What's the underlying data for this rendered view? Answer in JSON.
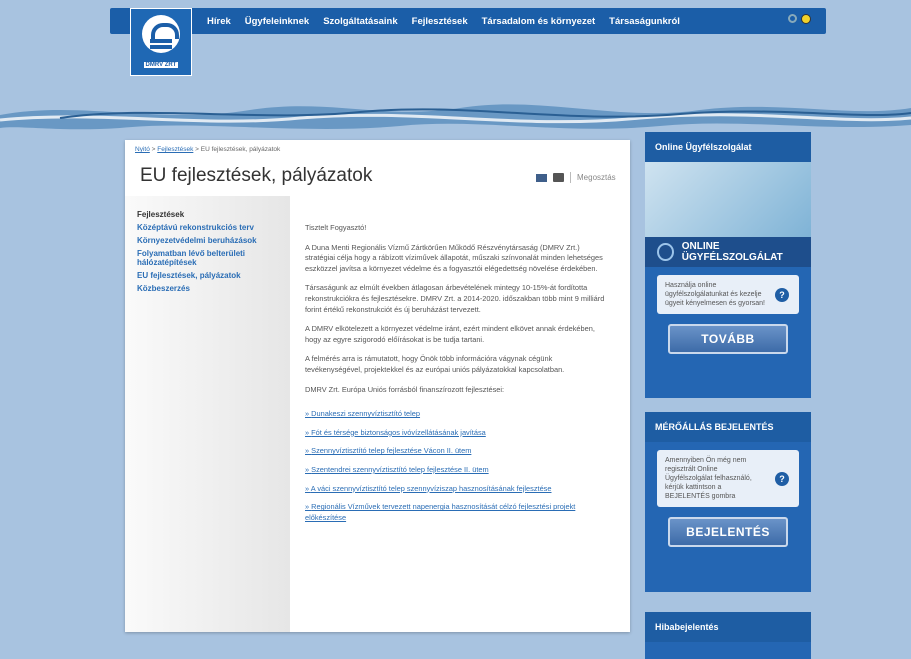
{
  "logo": {
    "text": "DMRV ZRT"
  },
  "nav": [
    "Hírek",
    "Ügyfeleinknek",
    "Szolgáltatásaink",
    "Fejlesztések",
    "Társadalom és környezet",
    "Társaságunkról"
  ],
  "breadcrumb": {
    "home": "Nyitó",
    "sep1": " > ",
    "parent": "Fejlesztések",
    "sep2": " > ",
    "current": "EU fejlesztések, pályázatok"
  },
  "page": {
    "title": "EU fejlesztések, pályázatok",
    "share": "Megosztás"
  },
  "leftnav": {
    "header": "Fejlesztések",
    "items": [
      "Középtávú rekonstrukciós terv",
      "Környezetvédelmi beruházások",
      "Folyamatban lévő belterületi hálózatépítések",
      "EU fejlesztések, pályázatok",
      "Közbeszerzés"
    ]
  },
  "main": {
    "greeting": "Tisztelt Fogyasztó!",
    "p1": "A Duna Menti Regionális Vízmű Zártkörűen Működő Részvénytársaság (DMRV Zrt.) stratégiai célja hogy a rábízott víziművek állapotát, műszaki színvonalát minden lehetséges eszközzel javítsa a környezet védelme és a fogyasztói elégedettség növelése érdekében.",
    "p2": "Társaságunk az elmúlt években átlagosan árbevételének mintegy 10-15%-át fordította rekonstrukciókra és fejlesztésekre. DMRV Zrt. a 2014-2020. időszakban több mint 9 milliárd forint értékű rekonstrukciót és új beruházást tervezett.",
    "p3": "A DMRV elkötelezett a környezet védelme iránt, ezért mindent elkövet annak érdekében, hogy az egyre szigorodó előírásokat is be tudja tartani.",
    "p4": "A felmérés arra is rámutatott, hogy Önök több információra vágynak cégünk tevékenységével, projektekkel és az európai uniós pályázatokkal kapcsolatban.",
    "p5": "DMRV Zrt. Európa Uniós forrásból finanszírozott fejlesztései:",
    "links": [
      "Dunakeszi szennyvíztisztító telep",
      "Fót és térsége biztonságos ivóvízellátásának javítása",
      "Szennyvíztisztító telep fejlesztése Vácon II. ütem",
      "Szentendrei szennyvíztisztító telep fejlesztése II. ütem",
      "A váci szennyvíztisztító telep szennyvíziszap hasznosításának fejlesztése",
      "Regionális Vízművek tervezett napenergia hasznosítását célzó fejlesztési projekt előkészítése"
    ]
  },
  "side1": {
    "header": "Online Ügyfélszolgálat",
    "band": "ONLINE ÜGYFÉLSZOLGÁLAT",
    "info": "Használja online ügyfélszolgálatunkat és kezelje ügyeit kényelmesen és gyorsan!",
    "button": "TOVÁBB"
  },
  "side2": {
    "header": "MÉRŐÁLLÁS BEJELENTÉS",
    "info": "Amennyiben Ön még nem regisztrált Online Ügyfélszolgálat felhasználó, kérjük kattintson a BEJELENTÉS gombra",
    "button": "BEJELENTÉS"
  },
  "side3": {
    "header": "Hibabejelentés"
  }
}
